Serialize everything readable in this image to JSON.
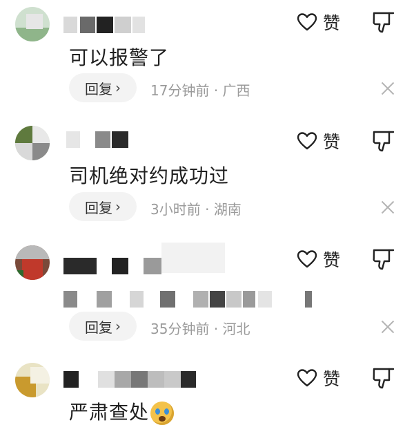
{
  "like_label": "赞",
  "comments": [
    {
      "text": "可以报警了",
      "reply_label": "回复",
      "time": "17分钟前",
      "location": "广西",
      "meta_sep": "·"
    },
    {
      "text": "司机绝对约成功过",
      "reply_label": "回复",
      "time": "3小时前",
      "location": "湖南",
      "meta_sep": "·"
    },
    {
      "text": "",
      "reply_label": "回复",
      "time": "35分钟前",
      "location": "河北",
      "meta_sep": "·"
    },
    {
      "text": "严肃查处",
      "emoji": "shocked-face-emoji"
    }
  ],
  "icons": {
    "like": "heart-outline-icon",
    "dislike": "thumbs-down-icon",
    "close": "close-icon",
    "reply_chevron": "chevron-right-icon"
  }
}
